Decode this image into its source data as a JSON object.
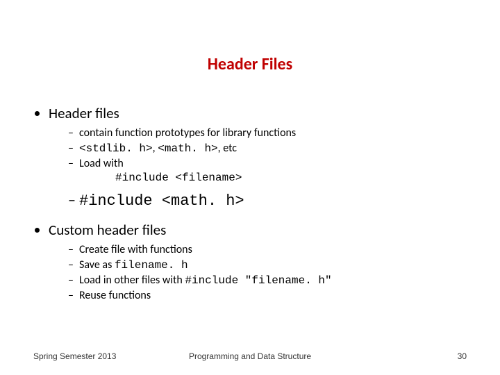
{
  "title": "Header Files",
  "bullets": {
    "b1": "Header files",
    "b1_sub": {
      "s1": "contain function prototypes for library functions",
      "s2_pre": "<stdlib. h>",
      "s2_mid": ", ",
      "s2_math": "<math. h>",
      "s2_post": ", etc",
      "s3": "Load with",
      "s3_code": "#include <filename>",
      "s4_code": "#include <math. h>"
    },
    "b2": "Custom header files",
    "b2_sub": {
      "s1": "Create file with functions",
      "s2_pre": "Save as ",
      "s2_code": "filename. h",
      "s3_pre": "Load in other files with ",
      "s3_code": "#include \"filename. h\"",
      "s4": "Reuse functions"
    }
  },
  "footer": {
    "left": "Spring Semester 2013",
    "center": "Programming and Data Structure",
    "right": "30"
  }
}
